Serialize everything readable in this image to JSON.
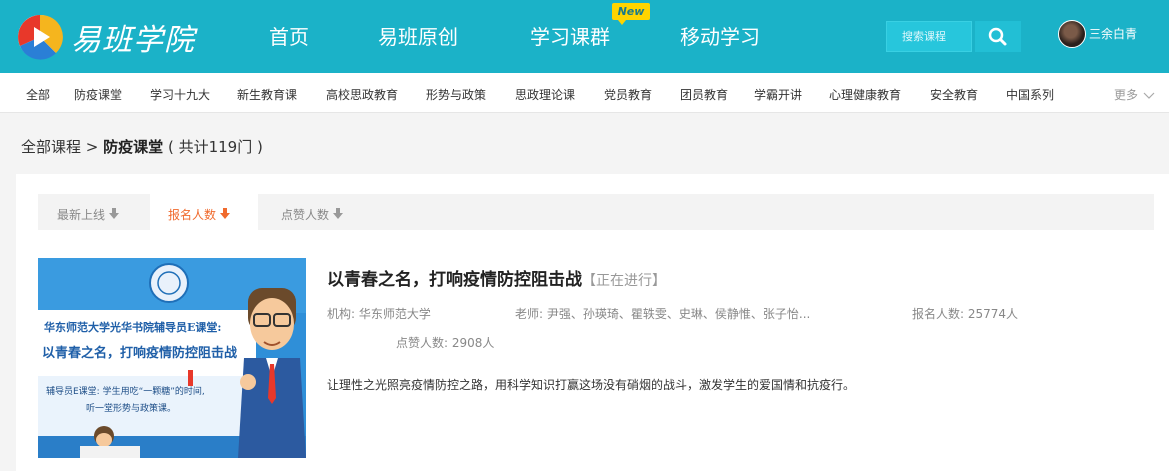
{
  "header": {
    "logo_text": "易班学院",
    "nav": [
      {
        "label": "首页"
      },
      {
        "label": "易班原创"
      },
      {
        "label": "学习课群"
      },
      {
        "label": "移动学习"
      }
    ],
    "new_badge": "New",
    "search_placeholder": "搜索课程",
    "username": "三余白青"
  },
  "categories": [
    "全部",
    "防疫课堂",
    "学习十九大",
    "新生教育课",
    "高校思政教育",
    "形势与政策",
    "思政理论课",
    "党员教育",
    "团员教育",
    "学霸开讲",
    "心理健康教育",
    "安全教育",
    "中国系列"
  ],
  "more_label": "更多",
  "breadcrumb": {
    "root": "全部课程",
    "separator": ">",
    "current": "防疫课堂",
    "count": "( 共计119门 )"
  },
  "sort": [
    {
      "label": "最新上线"
    },
    {
      "label": "报名人数"
    },
    {
      "label": "点赞人数"
    }
  ],
  "course": {
    "title": "以青春之名，打响疫情防控阻击战",
    "status": "【正在进行】",
    "org_label": "机构:",
    "org": "华东师范大学",
    "teacher_label": "老师:",
    "teachers": "尹强、孙瑛琦、瞿轶雯、史琳、侯静惟、张子怡...",
    "enroll_label": "报名人数:",
    "enroll": "25774人",
    "likes_label": "点赞人数:",
    "likes": "2908人",
    "description": "让理性之光照亮疫情防控之路，用科学知识打赢这场没有硝烟的战斗，激发学生的爱国情和抗疫行。",
    "thumb_line1": "华东师范大学光华书院辅导员E课堂:",
    "thumb_line2": "以青春之名，打响疫情防控阻击战",
    "thumb_line3": "辅导员E课堂: 学生用吃“一颗糖”的时间,",
    "thumb_line4": "听一堂形势与政策课。"
  }
}
